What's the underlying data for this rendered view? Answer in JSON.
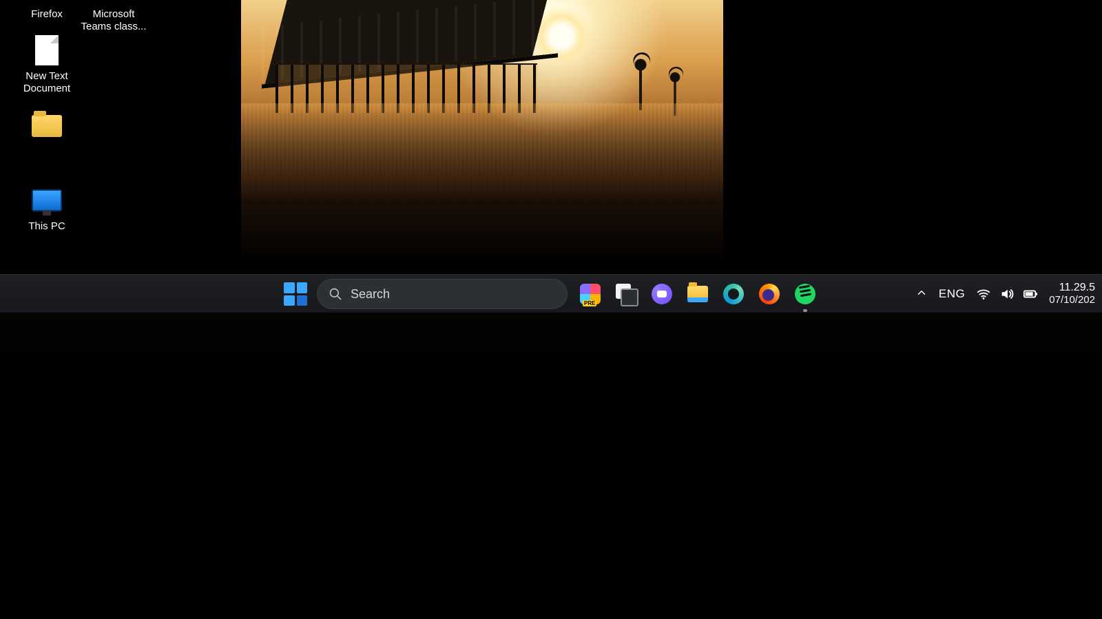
{
  "desktop_icons": {
    "firefox": "Firefox",
    "teams": "Microsoft Teams class...",
    "new_text": "New Text Document",
    "folder": "",
    "this_pc": "This PC"
  },
  "taskbar": {
    "search_placeholder": "Search",
    "pins": {
      "copilot": "Copilot Preview",
      "task_view": "Task View",
      "chat": "Chat",
      "explorer": "File Explorer",
      "edge": "Microsoft Edge",
      "firefox": "Firefox",
      "spotify": "Spotify"
    }
  },
  "tray": {
    "language": "ENG",
    "time": "11.29.5",
    "date": "07/10/202"
  }
}
